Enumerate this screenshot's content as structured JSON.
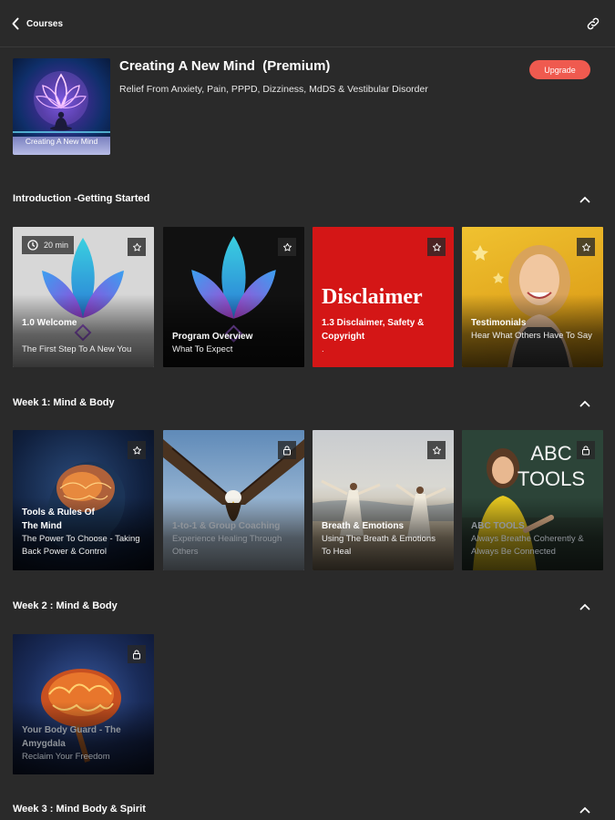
{
  "header": {
    "back_label": "Courses",
    "link_icon": "link-icon"
  },
  "course": {
    "title": "Creating A New Mind  (Premium)",
    "subtitle": "Relief From Anxiety, Pain, PPPD, Dizziness, MdDS & Vestibular Disorder",
    "thumb_label": "Creating A New Mind",
    "upgrade_label": "Upgrade"
  },
  "sections": [
    {
      "title": "Introduction -Getting Started",
      "cards": [
        {
          "title": "1.0 Welcome",
          "subtitle": "The First Step To A New You",
          "duration": "20 min",
          "badge": "star-icon"
        },
        {
          "title": "Program Overview",
          "subtitle": "What To Expect",
          "badge": "star-icon"
        },
        {
          "title": "1.3 Disclaimer, Safety & Copyright",
          "subtitle": ".",
          "image_text": "Disclaimer",
          "badge": "star-icon"
        },
        {
          "title": "Testimonials",
          "subtitle": "Hear What Others Have To Say",
          "badge": "star-icon"
        }
      ]
    },
    {
      "title": "Week 1: Mind & Body",
      "cards": [
        {
          "title": "Tools & Rules Of The Mind",
          "subtitle": "The Power To Choose - Taking Back Power & Control",
          "badge": "star-icon"
        },
        {
          "title": "1-to-1 & Group Coaching",
          "subtitle": "Experience Healing Through Others",
          "badge": "lock-icon"
        },
        {
          "title": "Breath & Emotions",
          "subtitle": "Using The Breath & Emotions To Heal",
          "badge": "star-icon"
        },
        {
          "title": "ABC TOOLS",
          "subtitle": "Always Breathe Coherently & Always Be Connected",
          "image_text": "ABC TOOLS",
          "badge": "lock-icon"
        }
      ]
    },
    {
      "title": "Week 2 : Mind & Body",
      "cards": [
        {
          "title": "Your Body Guard - The Amygdala",
          "subtitle": "Reclaim Your Freedom",
          "badge": "lock-icon"
        }
      ]
    },
    {
      "title": "Week 3 : Mind Body & Spirit",
      "cards": []
    }
  ],
  "colors": {
    "background": "#2a2a2a",
    "accent": "#ef5a4f",
    "disclaimer_red": "#d41616"
  }
}
